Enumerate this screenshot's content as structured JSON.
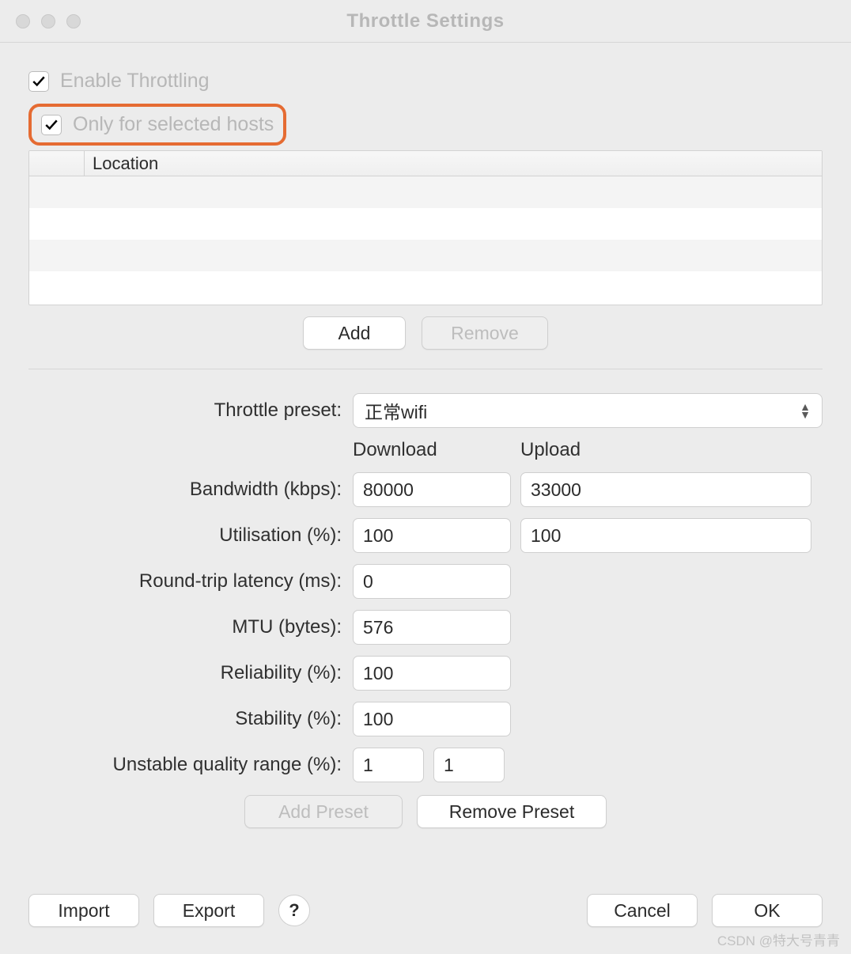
{
  "window": {
    "title": "Throttle Settings"
  },
  "checkboxes": {
    "enable_throttling": {
      "label": "Enable Throttling",
      "checked": true
    },
    "only_selected": {
      "label": "Only for selected hosts",
      "checked": true
    }
  },
  "table": {
    "columns": {
      "location": "Location"
    },
    "rows": []
  },
  "host_buttons": {
    "add": "Add",
    "remove": "Remove"
  },
  "form": {
    "preset_label": "Throttle preset:",
    "preset_value": "正常wifi",
    "download_header": "Download",
    "upload_header": "Upload",
    "bandwidth_label": "Bandwidth (kbps):",
    "bandwidth_download": "80000",
    "bandwidth_upload": "33000",
    "utilisation_label": "Utilisation (%):",
    "utilisation_download": "100",
    "utilisation_upload": "100",
    "rtt_label": "Round-trip latency (ms):",
    "rtt_value": "0",
    "mtu_label": "MTU (bytes):",
    "mtu_value": "576",
    "reliability_label": "Reliability (%):",
    "reliability_value": "100",
    "stability_label": "Stability (%):",
    "stability_value": "100",
    "unstable_label": "Unstable quality range (%):",
    "unstable_low": "1",
    "unstable_high": "1"
  },
  "preset_buttons": {
    "add": "Add Preset",
    "remove": "Remove Preset"
  },
  "footer": {
    "import": "Import",
    "export": "Export",
    "help": "?",
    "cancel": "Cancel",
    "ok": "OK"
  },
  "watermark": "CSDN @特大号青青"
}
